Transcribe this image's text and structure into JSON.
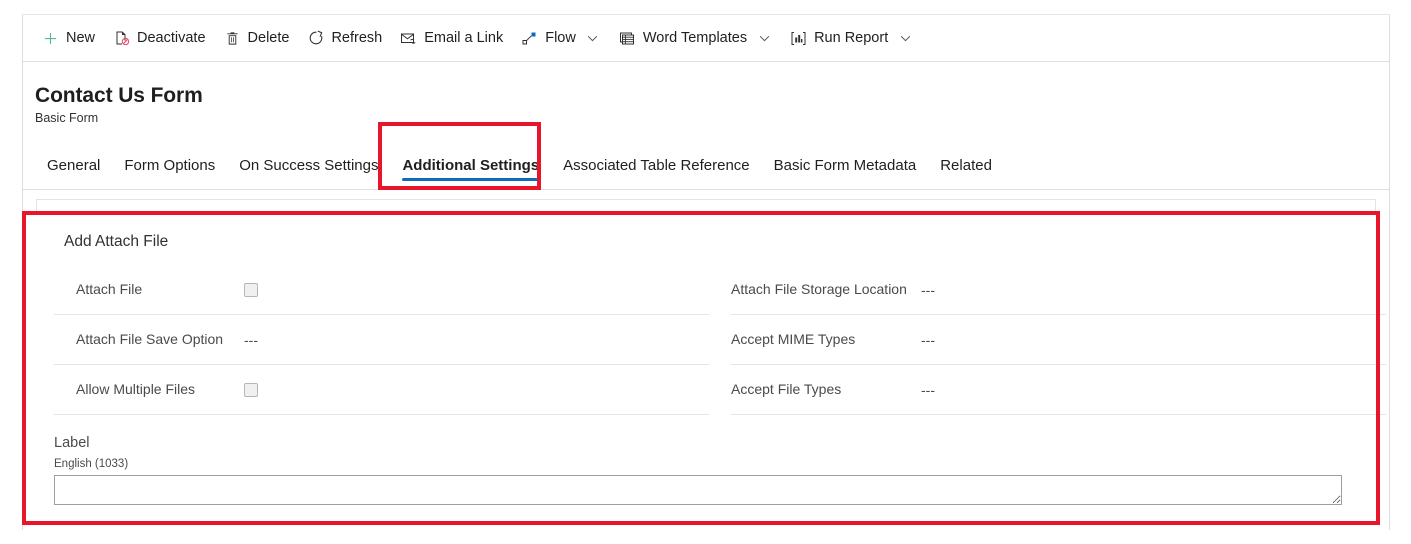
{
  "command_bar": {
    "items": [
      {
        "label": "New",
        "icon": "plus-icon",
        "has_caret": false
      },
      {
        "label": "Deactivate",
        "icon": "deactivate-icon",
        "has_caret": false
      },
      {
        "label": "Delete",
        "icon": "trash-icon",
        "has_caret": false
      },
      {
        "label": "Refresh",
        "icon": "refresh-icon",
        "has_caret": false
      },
      {
        "label": "Email a Link",
        "icon": "email-link-icon",
        "has_caret": false
      },
      {
        "label": "Flow",
        "icon": "flow-icon",
        "has_caret": true
      },
      {
        "label": "Word Templates",
        "icon": "word-templates-icon",
        "has_caret": true
      },
      {
        "label": "Run Report",
        "icon": "run-report-icon",
        "has_caret": true
      }
    ]
  },
  "header": {
    "title": "Contact Us Form",
    "subtitle": "Basic Form"
  },
  "tabs": [
    {
      "label": "General",
      "active": false
    },
    {
      "label": "Form Options",
      "active": false
    },
    {
      "label": "On Success Settings",
      "active": false
    },
    {
      "label": "Additional Settings",
      "active": true
    },
    {
      "label": "Associated Table Reference",
      "active": false
    },
    {
      "label": "Basic Form Metadata",
      "active": false
    },
    {
      "label": "Related",
      "active": false
    }
  ],
  "form": {
    "section_title": "Add Attach File",
    "left_column": [
      {
        "label": "Attach File",
        "control": "checkbox",
        "value": "",
        "checked": false
      },
      {
        "label": "Attach File Save Option",
        "control": "text",
        "value": "---"
      },
      {
        "label": "Allow Multiple Files",
        "control": "checkbox",
        "value": "",
        "checked": false
      }
    ],
    "right_column": [
      {
        "label": "Attach File Storage Location",
        "control": "text",
        "value": "---"
      },
      {
        "label": "Accept MIME Types",
        "control": "text",
        "value": "---"
      },
      {
        "label": "Accept File Types",
        "control": "text",
        "value": "---"
      }
    ],
    "label_block": {
      "heading": "Label",
      "language": "English (1033)",
      "value": "",
      "placeholder": ""
    }
  },
  "annotations": {
    "color": "#e8162a",
    "boxes": [
      {
        "name": "additional-settings-tab-highlight"
      },
      {
        "name": "add-attach-file-section-highlight"
      }
    ]
  },
  "colors": {
    "accent": "#0f6cbd",
    "annotation": "#e8162a",
    "text": "#201f1e",
    "muted_text": "#4a4a4a",
    "divider": "#e5e5e5"
  }
}
